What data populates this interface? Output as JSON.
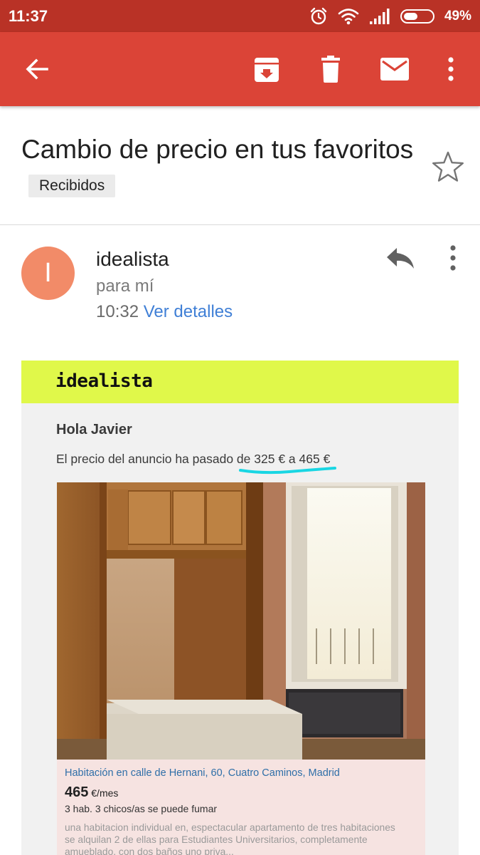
{
  "status_bar": {
    "time": "11:37",
    "battery_percent": "49%",
    "battery_level": 0.49
  },
  "app_bar": {
    "icons": [
      "back-arrow-icon",
      "archive-icon",
      "delete-icon",
      "mail-icon",
      "more-vert-icon"
    ]
  },
  "email": {
    "subject": "Cambio de precio en tus favoritos",
    "label": "Recibidos",
    "sender_initial": "I",
    "sender_name": "idealista",
    "recipient": "para mí",
    "time": "10:32",
    "details_link": "Ver detalles"
  },
  "message": {
    "brand": "idealista",
    "greeting": "Hola Javier",
    "price_change_prefix": "El precio del anuncio ha pasado de ",
    "price_change_values": "325 € a 465 €",
    "listing": {
      "title": "Habitación en calle de Hernani, 60, Cuatro Caminos, Madrid",
      "price": "465",
      "price_unit": "€/mes",
      "features": "3 hab. 3 chicos/as se puede fumar",
      "description": "una habitacion individual en, espectacular apartamento de tres habitaciones se alquilan 2 de ellas para Estudiantes Universitarios, completamente amueblado, con dos baños uno priva..."
    }
  },
  "colors": {
    "status_bar": "#b93226",
    "app_bar": "#db4437",
    "avatar": "#f28b68",
    "brand_bar": "#e0f84a",
    "link": "#3f7fd6",
    "highlight": "#19d6e3"
  }
}
